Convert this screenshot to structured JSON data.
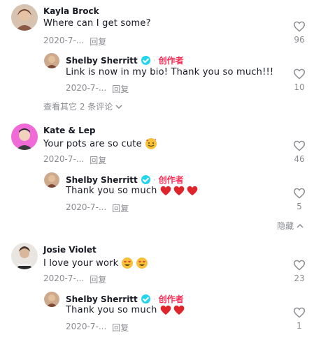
{
  "comments": [
    {
      "author": "Kayla Brock",
      "text": "Where can I get some?",
      "date": "2020-7-...",
      "reply_label": "回复",
      "likes": "96",
      "avatar_color": "#c9a98f",
      "reply": {
        "author": "Shelby Sherritt",
        "creator_label": "创作者",
        "text": "Link is now in my bio! Thank you so much!!!",
        "date": "2020-7-...",
        "reply_label": "回复",
        "likes": "10"
      },
      "more_replies": "查看其它 2 条评论"
    },
    {
      "author": "Kate & Lep",
      "text": "Your pots are so cute",
      "text_emoji": "smiling-face-with-hearts",
      "date": "2020-7-...",
      "reply_label": "回复",
      "likes": "46",
      "avatar_color": "#f06ad8",
      "reply": {
        "author": "Shelby Sherritt",
        "creator_label": "创作者",
        "text": "Thank you so much",
        "text_emoji": [
          "red-heart",
          "red-heart",
          "red-heart"
        ],
        "date": "2020-7-...",
        "reply_label": "回复",
        "likes": "5"
      },
      "hide_label": "隐藏"
    },
    {
      "author": "Josie Violet",
      "text": "I love your work",
      "text_emoji": [
        "heart-eyes",
        "heart-eyes"
      ],
      "date": "2020-7-...",
      "reply_label": "回复",
      "likes": "23",
      "avatar_color": "#6b6b6b",
      "reply": {
        "author": "Shelby Sherritt",
        "creator_label": "创作者",
        "text": "Thank you so much",
        "text_emoji": [
          "red-heart",
          "red-heart"
        ],
        "date": "2020-7-...",
        "reply_label": "回复",
        "likes": "1"
      }
    }
  ],
  "colors": {
    "creator": "#fe2c55",
    "verified": "#20d5ec",
    "meta": "#8a8b91",
    "text": "#161823"
  }
}
